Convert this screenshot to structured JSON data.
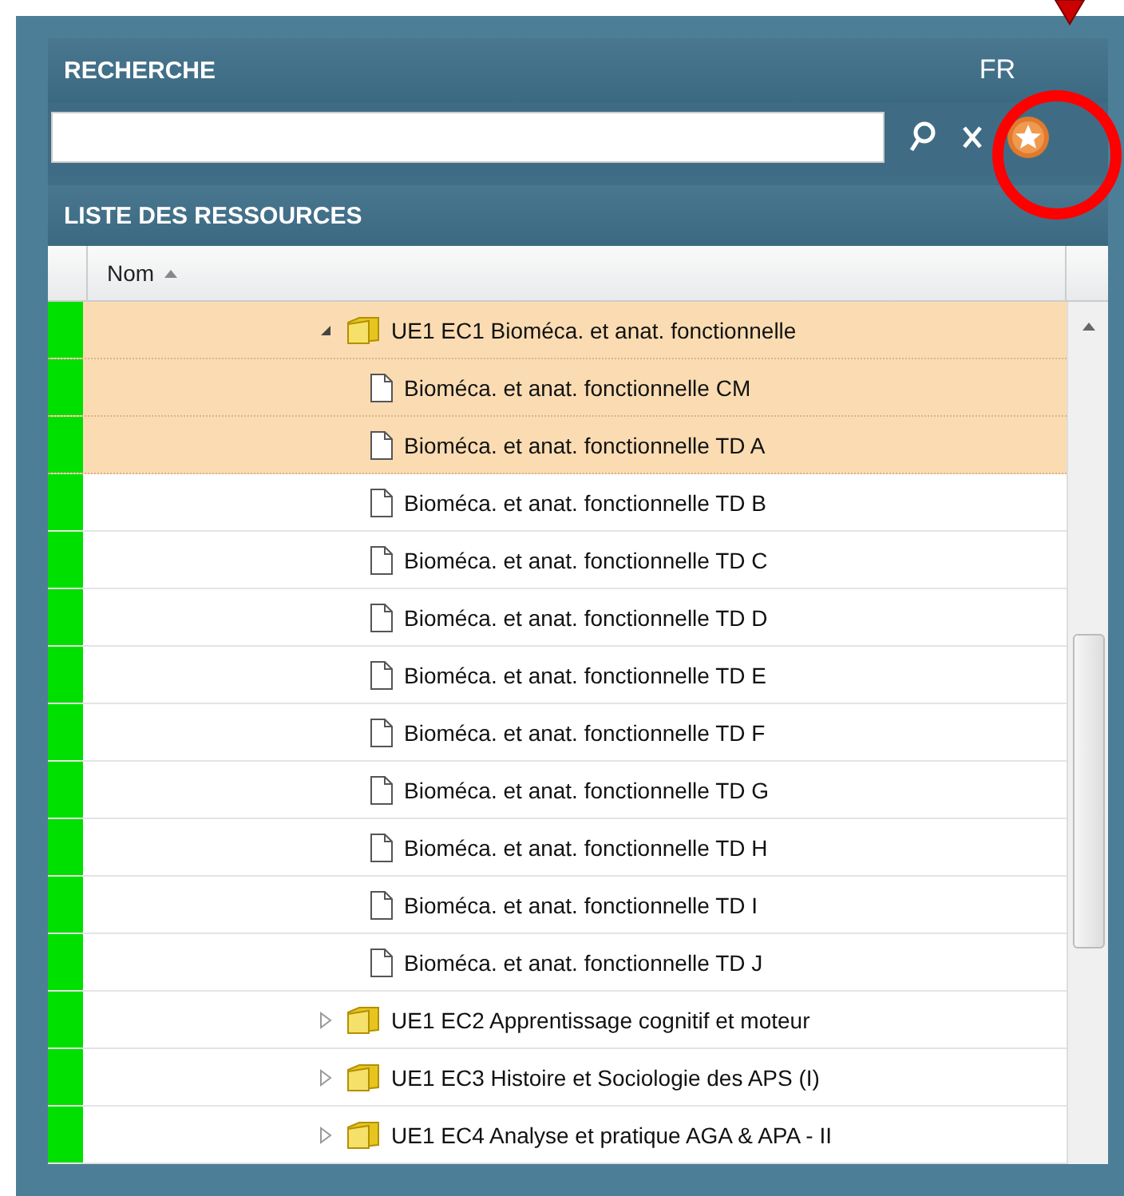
{
  "search": {
    "title": "RECHERCHE",
    "language": "FR"
  },
  "resources": {
    "title": "LISTE DES RESSOURCES",
    "column": "Nom",
    "tree": [
      {
        "label": "UE1 EC1 Bioméca. et anat. fonctionnelle",
        "kind": "folder",
        "expanded": true,
        "selected": true,
        "children": [
          {
            "label": "Bioméca. et anat. fonctionnelle CM",
            "kind": "file",
            "selected": true
          },
          {
            "label": "Bioméca. et anat. fonctionnelle TD A",
            "kind": "file",
            "selected": true
          },
          {
            "label": "Bioméca. et anat. fonctionnelle TD B",
            "kind": "file",
            "selected": false
          },
          {
            "label": "Bioméca. et anat. fonctionnelle TD C",
            "kind": "file",
            "selected": false
          },
          {
            "label": "Bioméca. et anat. fonctionnelle TD D",
            "kind": "file",
            "selected": false
          },
          {
            "label": "Bioméca. et anat. fonctionnelle TD E",
            "kind": "file",
            "selected": false
          },
          {
            "label": "Bioméca. et anat. fonctionnelle TD F",
            "kind": "file",
            "selected": false
          },
          {
            "label": "Bioméca. et anat. fonctionnelle TD G",
            "kind": "file",
            "selected": false
          },
          {
            "label": "Bioméca. et anat. fonctionnelle TD H",
            "kind": "file",
            "selected": false
          },
          {
            "label": "Bioméca. et anat. fonctionnelle TD I",
            "kind": "file",
            "selected": false
          },
          {
            "label": "Bioméca. et anat. fonctionnelle TD J",
            "kind": "file",
            "selected": false
          }
        ]
      },
      {
        "label": "UE1 EC2 Apprentissage cognitif et moteur",
        "kind": "folder",
        "expanded": false,
        "selected": false
      },
      {
        "label": "UE1 EC3 Histoire et Sociologie des APS (I)",
        "kind": "folder",
        "expanded": false,
        "selected": false
      },
      {
        "label": "UE1 EC4 Analyse et pratique AGA & APA - II",
        "kind": "folder",
        "expanded": false,
        "selected": false
      }
    ]
  }
}
